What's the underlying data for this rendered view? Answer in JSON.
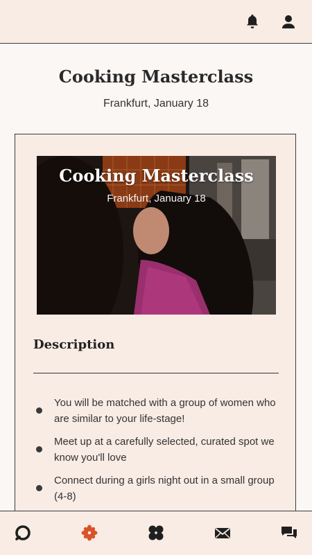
{
  "header": {
    "icons": [
      "bell-icon",
      "user-icon"
    ]
  },
  "page": {
    "title": "Cooking Masterclass",
    "subtitle": "Frankfurt, January 18"
  },
  "card": {
    "hero_title": "Cooking Masterclass",
    "hero_subtitle": "Frankfurt, January 18",
    "description_heading": "Description",
    "bullets": [
      "You will be matched with a group of women who are similar to your life-stage!",
      "Meet up at a carefully selected, curated spot we know you'll love",
      "Connect during a girls night out in a small group (4-8)"
    ]
  },
  "bottom_nav": {
    "items": [
      "home-icon",
      "events-icon",
      "clover-icon",
      "mail-icon",
      "chat-icon"
    ],
    "active": "events-icon"
  },
  "colors": {
    "accent": "#d9532a",
    "background": "#f9ece5",
    "text": "#2a2a2a"
  }
}
